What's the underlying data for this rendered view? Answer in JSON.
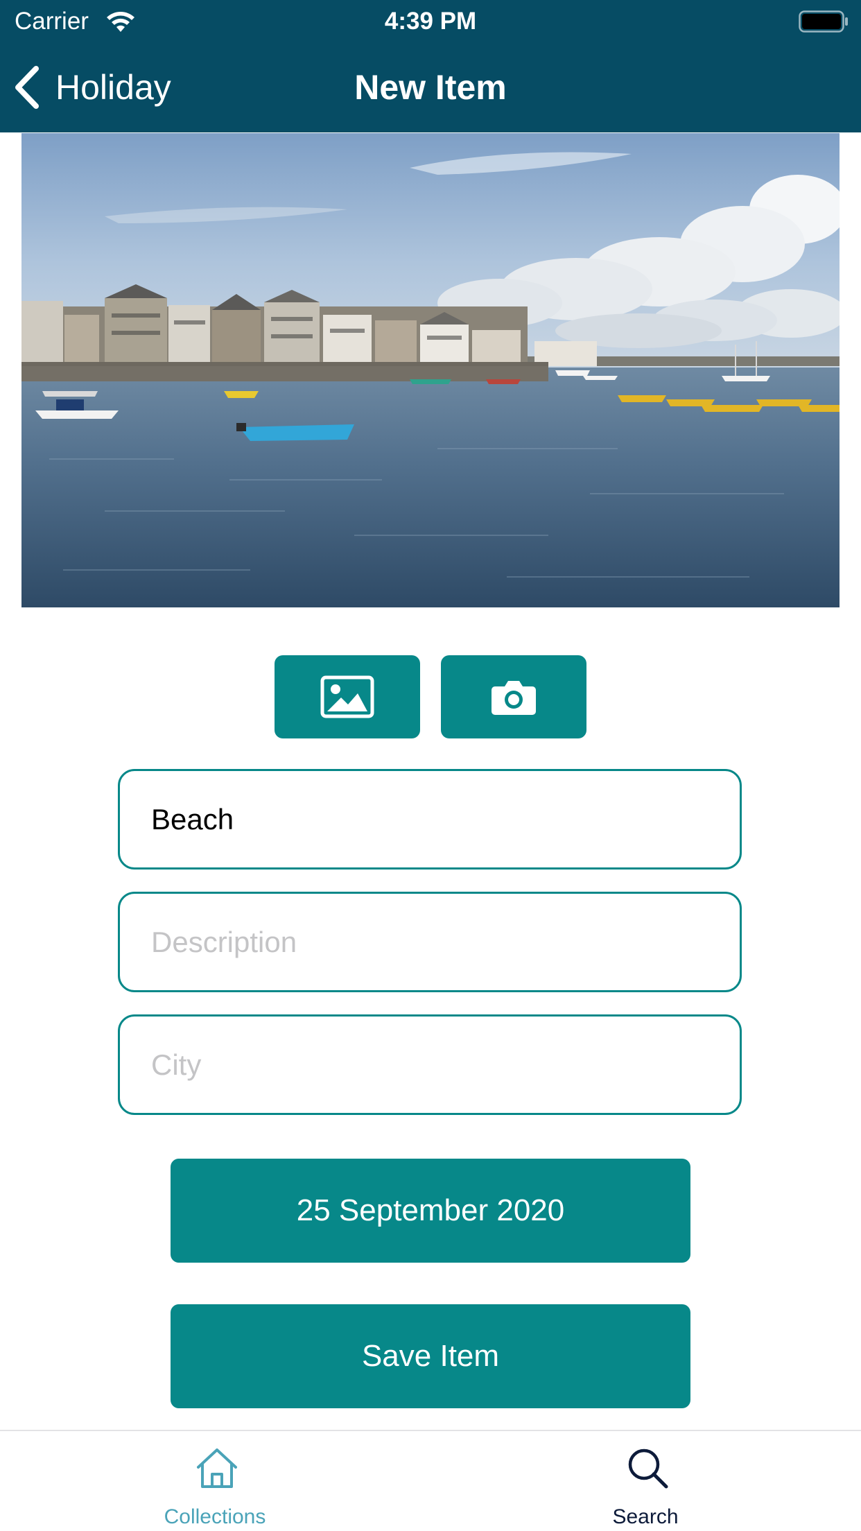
{
  "status_bar": {
    "carrier": "Carrier",
    "time": "4:39 PM",
    "icons": [
      "wifi-icon",
      "battery-icon"
    ]
  },
  "nav": {
    "back_label": "Holiday",
    "title": "New Item"
  },
  "photo": {
    "description": "harbour photo"
  },
  "media_buttons": {
    "gallery_icon": "image-icon",
    "camera_icon": "camera-icon"
  },
  "form": {
    "title_value": "Beach",
    "description_placeholder": "Description",
    "city_placeholder": "City"
  },
  "date_button": {
    "label": "25 September 2020"
  },
  "save_button": {
    "label": "Save Item"
  },
  "tabs": [
    {
      "label": "Collections",
      "icon": "home-icon",
      "active": true
    },
    {
      "label": "Search",
      "icon": "search-icon",
      "active": false
    }
  ],
  "colors": {
    "nav_background": "#064c64",
    "accent": "#078889",
    "active_tab": "#4aa3b8",
    "inactive_tab": "#0d1b3a"
  }
}
